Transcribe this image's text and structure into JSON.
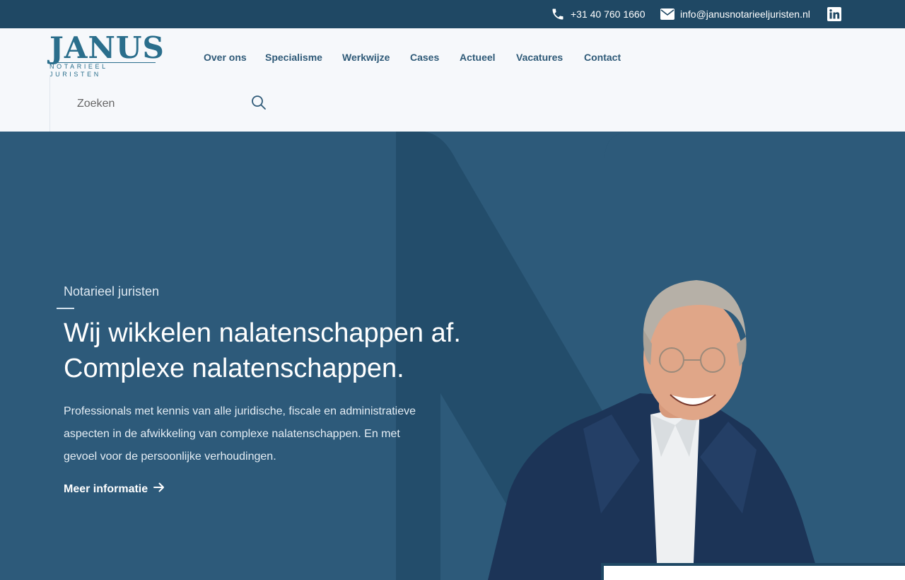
{
  "topbar": {
    "phone": "+31 40 760 1660",
    "email": "info@janusnotarieeljuristen.nl",
    "phone_icon": "phone-icon",
    "email_icon": "envelope-icon",
    "social_icon": "linkedin-icon"
  },
  "brand": {
    "name": "JANUS",
    "tagline": "NOTARIEEL JURISTEN"
  },
  "nav": {
    "items": [
      {
        "label": "Over ons"
      },
      {
        "label": "Specialisme"
      },
      {
        "label": "Werkwijze"
      },
      {
        "label": "Cases"
      },
      {
        "label": "Actueel"
      },
      {
        "label": "Vacatures"
      },
      {
        "label": "Contact"
      }
    ]
  },
  "search": {
    "placeholder": "Zoeken",
    "icon": "search-icon"
  },
  "hero": {
    "eyebrow": "Notarieel juristen",
    "headline_line1": "Wij wikkelen nalatenschappen af.",
    "headline_line2": "Complexe nalatenschappen.",
    "lead": "Professionals met kennis van alle juridische, fiscale en administratieve aspecten in de afwikkeling van complexe nalatenschappen. En met gevoel voor de persoonlijke verhoudingen.",
    "cta": "Meer informatie",
    "cta_icon": "arrow-right-icon"
  },
  "colors": {
    "topbar": "#1f4864",
    "hero": "#2d5a7a",
    "hero_shape": "#234d6b",
    "nav_text": "#2f5a78",
    "brand": "#2a6e8c"
  }
}
